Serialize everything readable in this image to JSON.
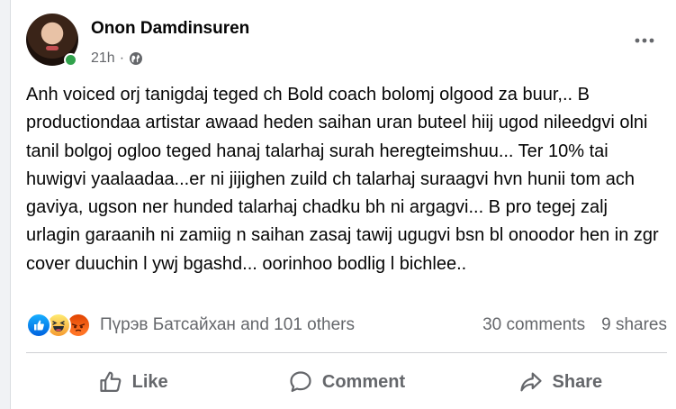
{
  "post": {
    "author": "Onon Damdinsuren",
    "time": "21h",
    "separator": "·",
    "audience_icon": "globe-icon",
    "more_icon": "more-options-icon",
    "text": "Anh voiced orj tanigdaj teged ch Bold coach bolomj olgood za buur,.. B productiondaa artistar awaad heden saihan uran buteel hiij ugod nileedgvi olni tanil bolgoj ogloo teged hanaj talarhaj surah heregteimshuu... Ter 10% tai huwigvi yaalaadaa...er ni jijighen zuild ch talarhaj suraagvi hvn hunii tom ach gaviya, ugson ner hunded talarhaj chadku bh ni argagvi... B pro tegej zalj urlagin garaanih ni zamiig n saihan zasaj tawij ugugvi bsn bl onoodor hen in zgr cover duuchin l ywj bgashd... oorinhoo bodlig l bichlee.."
  },
  "reactions": {
    "icons": [
      "like-reaction-icon",
      "haha-reaction-icon",
      "angry-reaction-icon"
    ],
    "summary": "Пүрэв Батсайхан and 101 others",
    "comments": "30 comments",
    "shares": "9 shares"
  },
  "actions": {
    "like": "Like",
    "comment": "Comment",
    "share": "Share"
  },
  "colors": {
    "background": "#f0f2f5",
    "card": "#ffffff",
    "secondary_text": "#65676b",
    "online": "#31a24c",
    "like_blue": "#0866ff"
  }
}
